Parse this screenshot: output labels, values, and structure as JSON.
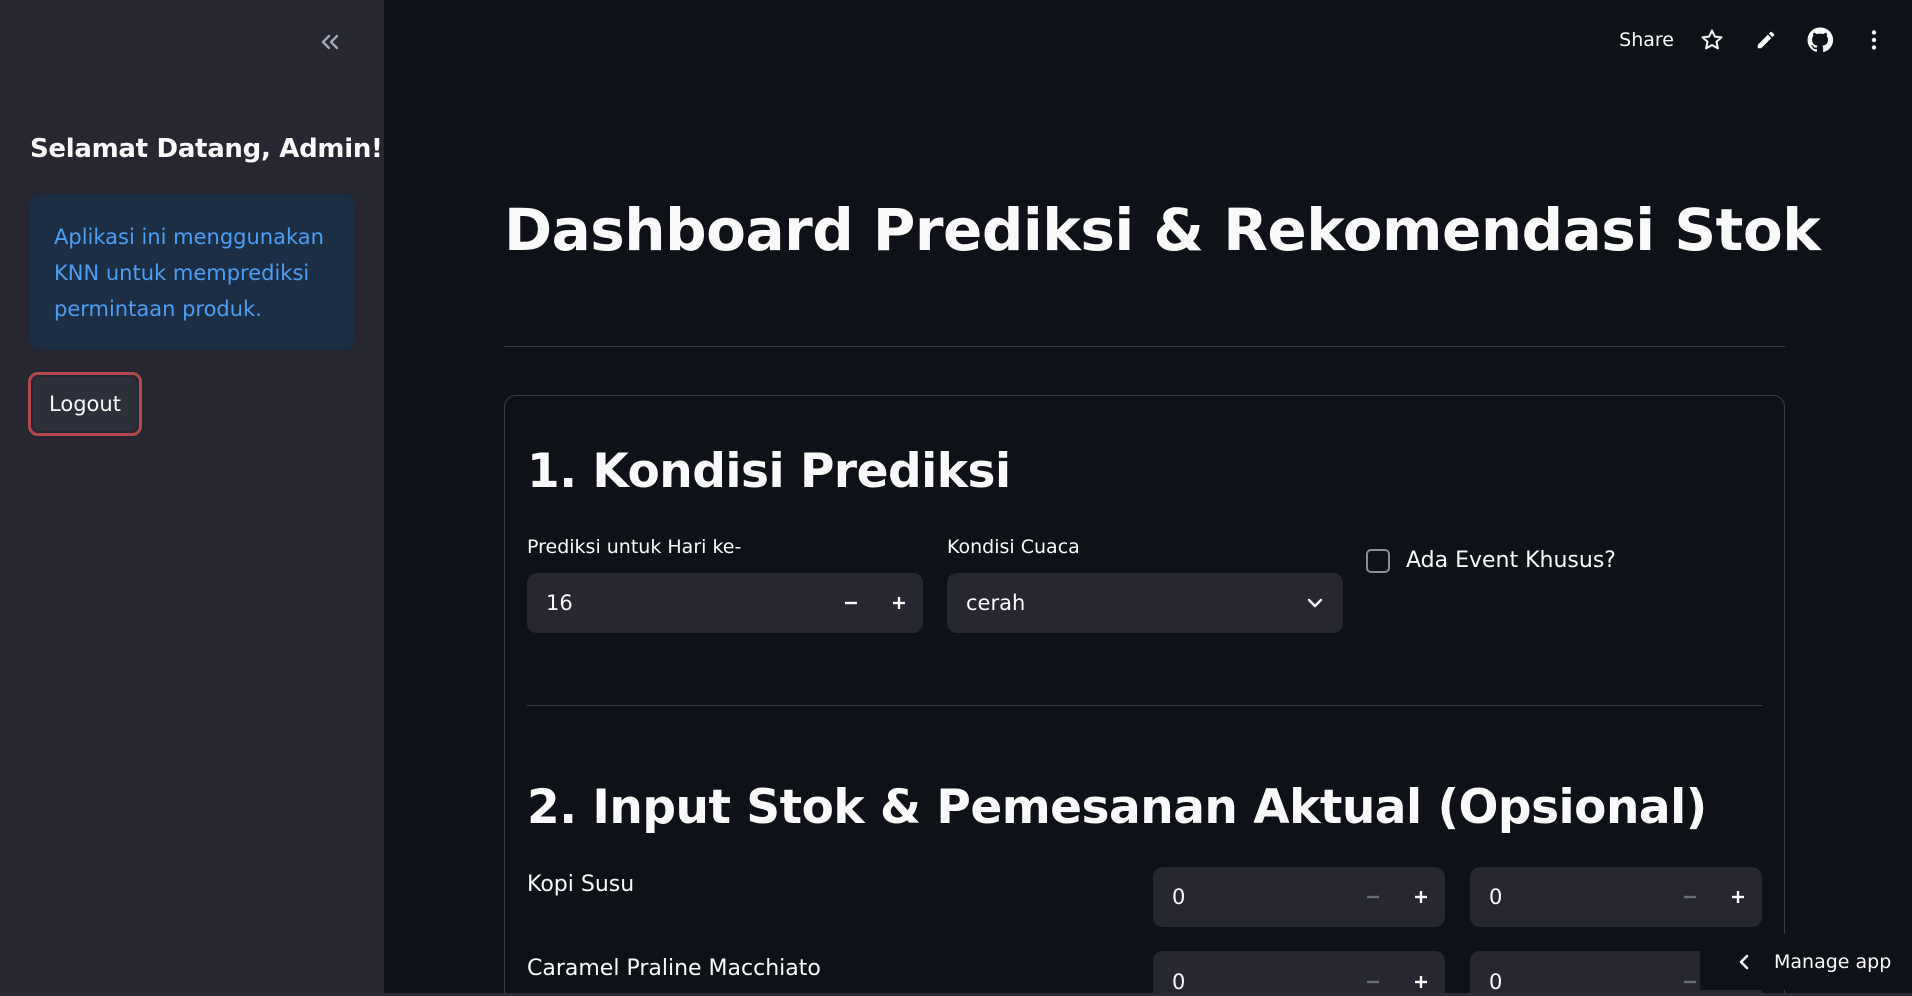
{
  "sidebar": {
    "title": "Selamat Datang, Admin!",
    "info_text": "Aplikasi ini menggunakan KNN untuk memprediksi permintaan produk.",
    "logout_label": "Logout",
    "collapse_icon": "double-chevron-left-icon"
  },
  "toolbar": {
    "share_label": "Share",
    "icons": [
      "star-icon",
      "pencil-icon",
      "github-icon",
      "more-vertical-icon"
    ]
  },
  "main": {
    "title": "Dashboard Prediksi & Rekomendasi Stok",
    "section1": {
      "title": "1. Kondisi Prediksi",
      "day_label": "Prediksi untuk Hari ke-",
      "day_value": "16",
      "weather_label": "Kondisi Cuaca",
      "weather_value": "cerah",
      "event_label": "Ada Event Khusus?",
      "event_checked": false
    },
    "section2": {
      "title": "2. Input Stok & Pemesanan Aktual (Opsional)",
      "products": [
        {
          "name": "Kopi Susu",
          "stock": "0",
          "order": "0"
        },
        {
          "name": "Caramel Praline Macchiato",
          "stock": "0",
          "order": "0"
        }
      ]
    }
  },
  "footer": {
    "manage_app_label": "Manage app"
  },
  "colors": {
    "background": "#0e1117",
    "sidebar": "#262730",
    "info_bg": "#1c2e44",
    "info_text": "#4a9ff5",
    "logout_border": "#b4494d"
  }
}
